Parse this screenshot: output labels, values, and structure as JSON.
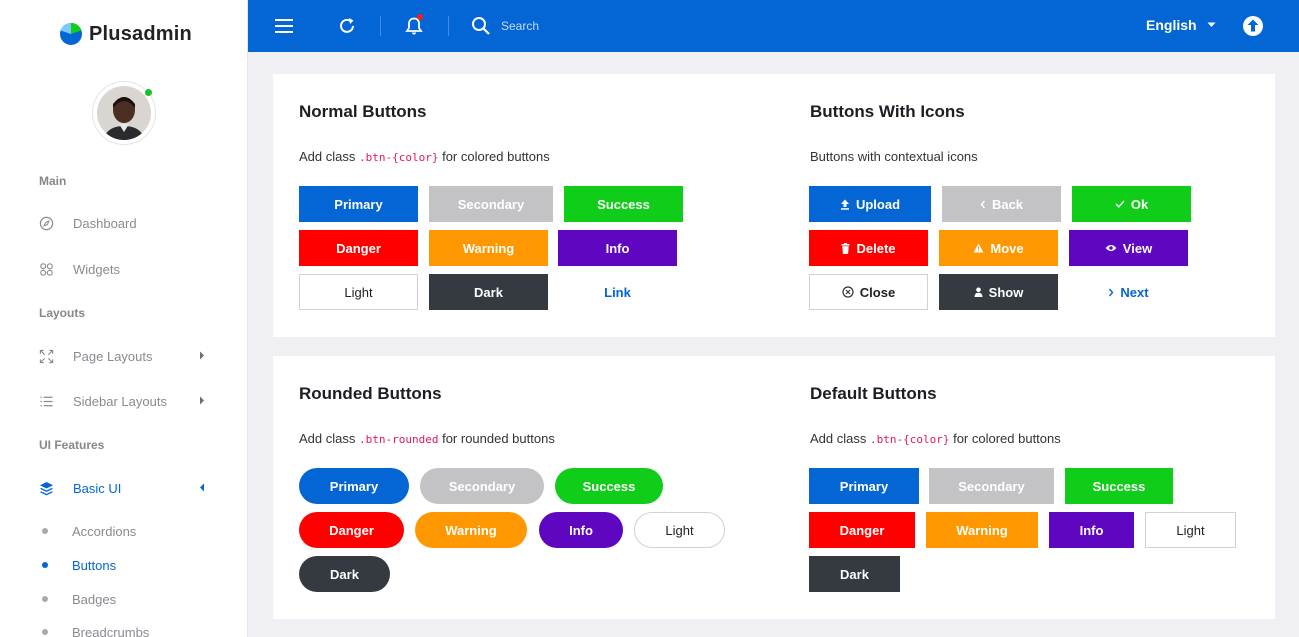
{
  "brand": {
    "name": "Plusadmin"
  },
  "sidebar": {
    "headings": [
      "Main",
      "Layouts",
      "UI Features"
    ],
    "items": [
      {
        "label": "Dashboard",
        "icon": "compass-icon"
      },
      {
        "label": "Widgets",
        "icon": "widgets-icon"
      },
      {
        "label": "Page Layouts",
        "icon": "expand-icon"
      },
      {
        "label": "Sidebar Layouts",
        "icon": "list-icon"
      },
      {
        "label": "Basic UI",
        "icon": "layers-icon",
        "active": true
      }
    ],
    "sub_items": [
      {
        "label": "Accordions"
      },
      {
        "label": "Buttons",
        "active": true
      },
      {
        "label": "Badges"
      },
      {
        "label": "Breadcrumbs"
      }
    ]
  },
  "topbar": {
    "search_placeholder": "Search",
    "language": "English"
  },
  "colors": {
    "primary": "#0466d5",
    "secondary": "#c3c3c6",
    "success": "#0fcd18",
    "danger": "#ff0000",
    "warning": "#ff9800",
    "info": "#5f06c0",
    "dark": "#343a40",
    "code": "#e2185b"
  },
  "sections": {
    "normal": {
      "title": "Normal Buttons",
      "desc_before": "Add class ",
      "desc_code": ".btn-{color}",
      "desc_after": " for colored buttons",
      "buttons": [
        "Primary",
        "Secondary",
        "Success",
        "Danger",
        "Warning",
        "Info",
        "Light",
        "Dark",
        "Link"
      ]
    },
    "icons": {
      "title": "Buttons With Icons",
      "desc": "Buttons with contextual icons",
      "buttons": [
        {
          "label": "Upload",
          "icon": "upload-icon"
        },
        {
          "label": "Back",
          "icon": "chevron-left-icon"
        },
        {
          "label": "Ok",
          "icon": "check-icon"
        },
        {
          "label": "Delete",
          "icon": "trash-icon"
        },
        {
          "label": "Move",
          "icon": "warning-triangle-icon"
        },
        {
          "label": "View",
          "icon": "eye-icon"
        },
        {
          "label": "Close",
          "icon": "close-circle-icon"
        },
        {
          "label": "Show",
          "icon": "user-icon"
        },
        {
          "label": "Next",
          "icon": "chevron-right-icon"
        }
      ]
    },
    "rounded": {
      "title": "Rounded Buttons",
      "desc_before": "Add class ",
      "desc_code": ".btn-rounded",
      "desc_after": " for rounded buttons",
      "buttons": [
        "Primary",
        "Secondary",
        "Success",
        "Danger",
        "Warning",
        "Info",
        "Light",
        "Dark"
      ]
    },
    "default": {
      "title": "Default Buttons",
      "desc_before": "Add class ",
      "desc_code": ".btn-{color}",
      "desc_after": " for colored buttons",
      "buttons": [
        "Primary",
        "Secondary",
        "Success",
        "Danger",
        "Warning",
        "Info",
        "Light",
        "Dark"
      ]
    }
  }
}
